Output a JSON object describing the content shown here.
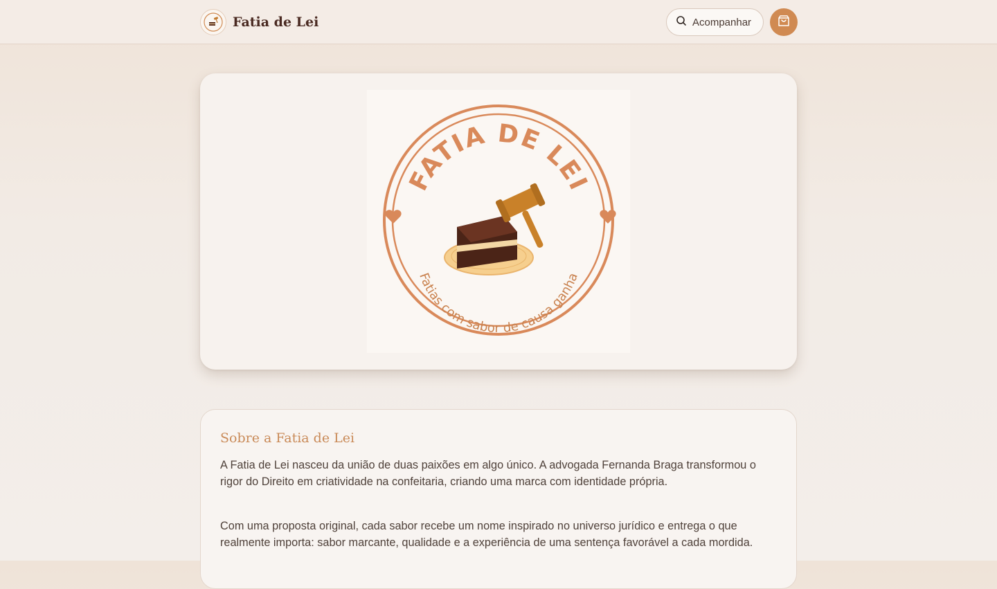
{
  "header": {
    "brand_name": "Fatia de Lei",
    "follow_label": "Acompanhar",
    "icons": {
      "search": "search-icon",
      "cart": "shopping-bag-icon"
    }
  },
  "hero": {
    "logo_top_text": "FATIA DE LEI",
    "logo_bottom_text": "Fatias com sabor de causa ganha"
  },
  "about": {
    "title": "Sobre a Fatia de Lei",
    "paragraphs": [
      "A Fatia de Lei nasceu da união de duas paixões em algo único. A advogada Fernanda Braga transformou o rigor do Direito em criatividade na confeitaria, criando uma marca com identidade própria.",
      "Com uma proposta original, cada sabor recebe um nome inspirado no universo jurídico e entrega o que realmente importa: sabor marcante, qualidade e a experiência de uma sentença favorável a cada mordida."
    ]
  },
  "colors": {
    "accent": "#d08a52",
    "brand_dark": "#4a2a22",
    "background": "#f2ebe5"
  }
}
